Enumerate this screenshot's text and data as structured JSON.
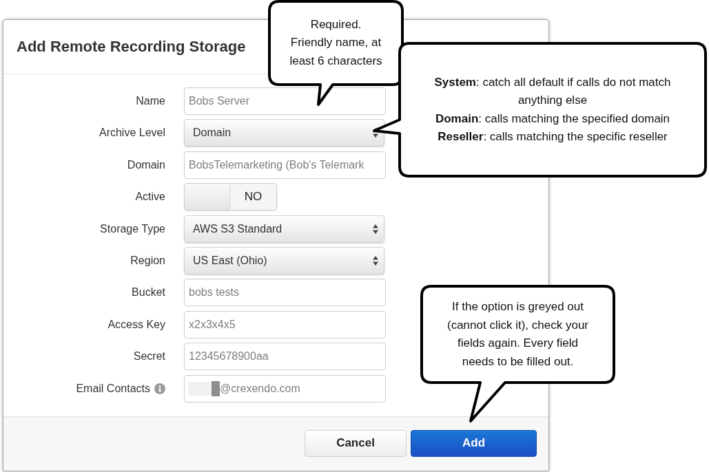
{
  "dialog": {
    "title": "Add Remote Recording Storage"
  },
  "form": {
    "fields": [
      {
        "label": "Name",
        "kind": "text",
        "value": "Bobs Server"
      },
      {
        "label": "Archive Level",
        "kind": "select",
        "value": "Domain"
      },
      {
        "label": "Domain",
        "kind": "text",
        "value": "BobsTelemarketing (Bob's Telemark"
      },
      {
        "label": "Active",
        "kind": "toggle",
        "on": false,
        "state_label": "NO"
      },
      {
        "label": "Storage Type",
        "kind": "select",
        "value": "AWS S3 Standard"
      },
      {
        "label": "Region",
        "kind": "select",
        "value": "US East (Ohio)"
      },
      {
        "label": "Bucket",
        "kind": "text",
        "value": "bobs tests"
      },
      {
        "label": "Access Key",
        "kind": "text",
        "value": "x2x3x4x5"
      },
      {
        "label": "Secret",
        "kind": "text",
        "value": "12345678900aa"
      },
      {
        "label": "Email Contacts",
        "kind": "text",
        "info": true,
        "redacted": true,
        "value": "@crexendo.com"
      }
    ]
  },
  "buttons": [
    {
      "label": "Cancel",
      "kind": "secondary"
    },
    {
      "label": "Add",
      "kind": "primary"
    }
  ],
  "callouts": [
    {
      "lines": [
        "Required.",
        "Friendly name, at least 6 characters"
      ]
    },
    {
      "lines": [
        "**System**: catch all default if calls do not match anything else",
        "**Domain**: calls matching the specified domain",
        "**Reseller**: calls matching the specific reseller"
      ]
    },
    {
      "lines": [
        "If the option is greyed out (cannot click it), check your fields again. Every field needs to be filled out."
      ]
    }
  ]
}
